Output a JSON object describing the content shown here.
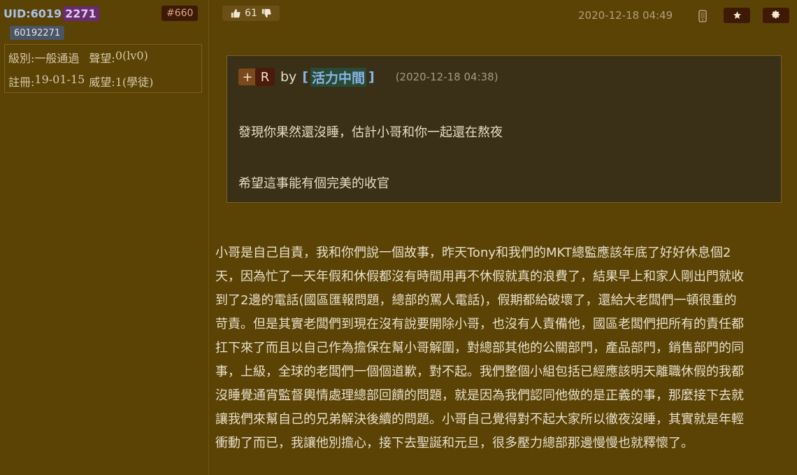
{
  "user": {
    "uid_prefix": "UID:6019",
    "uid_suffix": "2271",
    "uid_chip": "60192271",
    "floor": "#660",
    "level_label": "級別:",
    "level_value": "一般通過",
    "prestige_label": "聲望:",
    "prestige_value": "0(lv0)",
    "register_label": "註冊:",
    "register_value": "19-01-15",
    "reputation_label": "威望:",
    "reputation_value": "1(學徒)"
  },
  "post": {
    "likes": "61",
    "timestamp": "2020-12-18 04:49",
    "icons": {
      "like": "thumbs-up-icon",
      "dislike": "thumbs-down-icon",
      "device": "mobile-phone-icon",
      "favorite": "star-icon",
      "settings": "gear-icon"
    }
  },
  "quote": {
    "plus": "+",
    "r": "R",
    "by": "by",
    "bracket_open": "[",
    "author": "活力中間",
    "bracket_close": "]",
    "date": "(2020-12-18 04:38)",
    "line1": "發現你果然還沒睡，估計小哥和你一起還在熬夜",
    "line2": "希望這事能有個完美的收官"
  },
  "body": {
    "lines": [
      "小哥是自己自責，我和你們說一個故事，昨天Tony和我們的MKT總監應該年底了好好休息個2",
      "天，因為忙了一天年假和休假都沒有時間用再不休假就真的浪費了，結果早上和家人剛出門就收",
      "到了2邊的電話(國區匯報問題，總部的罵人電話)，假期都給破壞了，還給大老闆們一頓很重的",
      "苛責。但是其實老闆們到現在沒有說要開除小哥，也沒有人責備他，國區老闆們把所有的責任都",
      "扛下來了而且以自己作為擔保在幫小哥解圍，對總部其他的公關部門，產品部門，銷售部門的同",
      "事，上級，全球的老闆們一個個道歉，對不起。我們整個小組包括已經應該明天離職休假的我都",
      "沒睡覺通宵監督輿情處理總部回饋的問題，就是因為我們認同他做的是正義的事，那麼接下去就",
      "讓我們來幫自己的兄弟解決後續的問題。小哥自己覺得對不起大家所以徹夜沒睡，其實就是年輕",
      "衝動了而已，我讓他別擔心，接下去聖誕和元旦，很多壓力總部那邊慢慢也就釋懷了。"
    ]
  },
  "colors": {
    "background": "#5b4205",
    "quote_bg": "#3a3018",
    "text": "#e8e0cc",
    "author": "#88b4e8",
    "badge_dark": "#3e1a05"
  }
}
